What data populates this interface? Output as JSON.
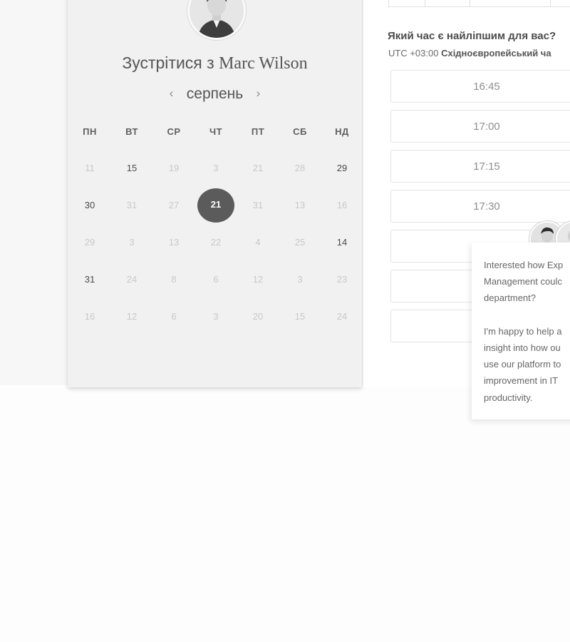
{
  "scheduler": {
    "title_prefix": "Зустрітися з",
    "host_name": "Marc Wilson",
    "month": "серпень",
    "prev_label": "‹",
    "next_label": "›",
    "weekdays": [
      "ПН",
      "ВТ",
      "СР",
      "ЧТ",
      "ПТ",
      "СБ",
      "НД"
    ],
    "weeks": [
      [
        {
          "n": "11",
          "s": "disabled"
        },
        {
          "n": "15",
          "s": "available"
        },
        {
          "n": "19",
          "s": "disabled"
        },
        {
          "n": "3",
          "s": "disabled"
        },
        {
          "n": "21",
          "s": "disabled"
        },
        {
          "n": "28",
          "s": "disabled"
        },
        {
          "n": "29",
          "s": "available"
        }
      ],
      [
        {
          "n": "30",
          "s": "available"
        },
        {
          "n": "31",
          "s": "disabled"
        },
        {
          "n": "27",
          "s": "disabled"
        },
        {
          "n": "21",
          "s": "selected"
        },
        {
          "n": "31",
          "s": "disabled"
        },
        {
          "n": "13",
          "s": "disabled"
        },
        {
          "n": "16",
          "s": "disabled"
        }
      ],
      [
        {
          "n": "29",
          "s": "disabled"
        },
        {
          "n": "3",
          "s": "disabled"
        },
        {
          "n": "13",
          "s": "disabled"
        },
        {
          "n": "22",
          "s": "disabled"
        },
        {
          "n": "4",
          "s": "disabled"
        },
        {
          "n": "25",
          "s": "disabled"
        },
        {
          "n": "14",
          "s": "available"
        }
      ],
      [
        {
          "n": "31",
          "s": "available"
        },
        {
          "n": "24",
          "s": "disabled"
        },
        {
          "n": "8",
          "s": "disabled"
        },
        {
          "n": "6",
          "s": "disabled"
        },
        {
          "n": "12",
          "s": "disabled"
        },
        {
          "n": "3",
          "s": "disabled"
        },
        {
          "n": "23",
          "s": "disabled"
        }
      ],
      [
        {
          "n": "16",
          "s": "disabled"
        },
        {
          "n": "12",
          "s": "disabled"
        },
        {
          "n": "6",
          "s": "disabled"
        },
        {
          "n": "3",
          "s": "disabled"
        },
        {
          "n": "20",
          "s": "disabled"
        },
        {
          "n": "15",
          "s": "disabled"
        },
        {
          "n": "24",
          "s": "disabled"
        }
      ]
    ]
  },
  "times": {
    "question": "Який час є найліпшим для вас?",
    "tz_offset": "UTC +03:00",
    "tz_name": "Східноєвропейський ча",
    "slots": [
      "16:45",
      "17:00",
      "17:15",
      "17:30",
      "",
      "",
      ""
    ]
  },
  "chat": {
    "message": "Interested how Exp\nManagement coulc\ndepartment?\n\nI'm happy to help a\ninsight into how ou\nuse our platform to\nimprovement in IT\nproductivity."
  },
  "icons": {
    "prev": "chevron-left-icon",
    "next": "chevron-right-icon"
  }
}
